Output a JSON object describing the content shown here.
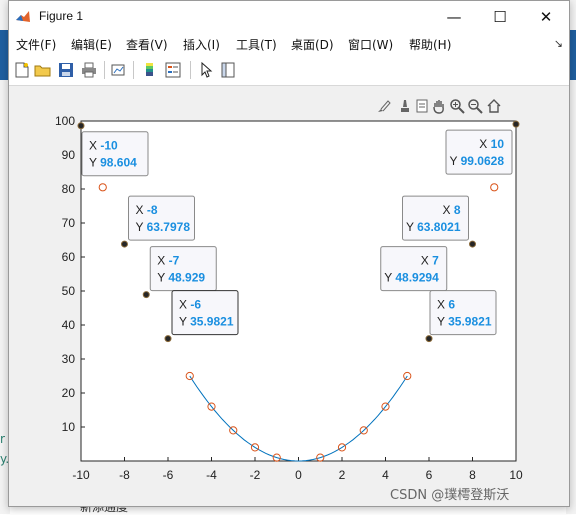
{
  "window": {
    "title": "Figure 1",
    "controls": {
      "minimize": "—",
      "maximize": "☐",
      "close": "✕"
    }
  },
  "menu": {
    "items": [
      {
        "label": "文件(F)"
      },
      {
        "label": "编辑(E)"
      },
      {
        "label": "查看(V)"
      },
      {
        "label": "插入(I)"
      },
      {
        "label": "工具(T)"
      },
      {
        "label": "桌面(D)"
      },
      {
        "label": "窗口(W)"
      },
      {
        "label": "帮助(H)"
      }
    ],
    "overflow": "↘"
  },
  "toolbar": {
    "icons": [
      "new-figure-icon",
      "open-file-icon",
      "save-icon",
      "print-icon",
      "link-plot-icon",
      "insert-colorbar-icon",
      "insert-legend-icon",
      "edit-plot-icon",
      "property-inspector-icon"
    ]
  },
  "axes_toolbar": {
    "icons": [
      "brush-icon",
      "data-tips-icon",
      "export-icon",
      "pan-icon",
      "zoom-in-icon",
      "zoom-out-icon",
      "home-icon"
    ]
  },
  "chart_data": {
    "type": "line",
    "xlim": [
      -10,
      10
    ],
    "ylim": [
      0,
      100
    ],
    "xticks": [
      -10,
      -8,
      -6,
      -4,
      -2,
      0,
      2,
      4,
      6,
      8,
      10
    ],
    "yticks": [
      10,
      20,
      30,
      40,
      50,
      60,
      70,
      80,
      90,
      100
    ],
    "grid": false,
    "line_color": "#0072BD",
    "marker_color": "#D95319",
    "datatip_color": "#1a8fe0",
    "line": {
      "x": [
        -5,
        -4,
        -3,
        -2,
        -1,
        0,
        1,
        2,
        3,
        4,
        5
      ],
      "y": [
        25,
        16,
        9,
        4,
        1,
        0,
        1,
        4,
        9,
        16,
        25
      ]
    },
    "markers": {
      "x": [
        -9,
        -5,
        -4,
        -3,
        -2,
        -1,
        1,
        2,
        3,
        4,
        5,
        9
      ],
      "y": [
        80.5,
        25,
        16,
        9,
        4,
        1,
        1,
        4,
        9,
        16,
        25,
        80.5
      ]
    },
    "datatips": [
      {
        "x": -10,
        "y": 98.604,
        "x_label": "X",
        "y_label": "Y",
        "x_text": "-10",
        "y_text": "98.604",
        "side": "right"
      },
      {
        "x": -8,
        "y": 63.7978,
        "x_label": "X",
        "y_label": "Y",
        "x_text": "-8",
        "y_text": "63.7978",
        "side": "right"
      },
      {
        "x": -7,
        "y": 48.929,
        "x_label": "X",
        "y_label": "Y",
        "x_text": "-7",
        "y_text": "48.929",
        "side": "right"
      },
      {
        "x": -6,
        "y": 35.9821,
        "x_label": "X",
        "y_label": "Y",
        "x_text": "-6",
        "y_text": "35.9821",
        "side": "right",
        "selected": true
      },
      {
        "x": 10,
        "y": 99.0628,
        "x_label": "X",
        "y_label": "Y",
        "x_text": "10",
        "y_text": "99.0628",
        "side": "left"
      },
      {
        "x": 8,
        "y": 63.8021,
        "x_label": "X",
        "y_label": "Y",
        "x_text": "8",
        "y_text": "63.8021",
        "side": "left"
      },
      {
        "x": 7,
        "y": 48.9294,
        "x_label": "X",
        "y_label": "Y",
        "x_text": "7",
        "y_text": "48.9294",
        "side": "left"
      },
      {
        "x": 6,
        "y": 35.9821,
        "x_label": "X",
        "y_label": "Y",
        "x_text": "6",
        "y_text": "35.9821",
        "side": "right"
      }
    ]
  },
  "background": {
    "bottom_text": "新添通度",
    "left_fragments": [
      "r",
      "y."
    ]
  },
  "watermark": "CSDN @璞樗登斯沃"
}
